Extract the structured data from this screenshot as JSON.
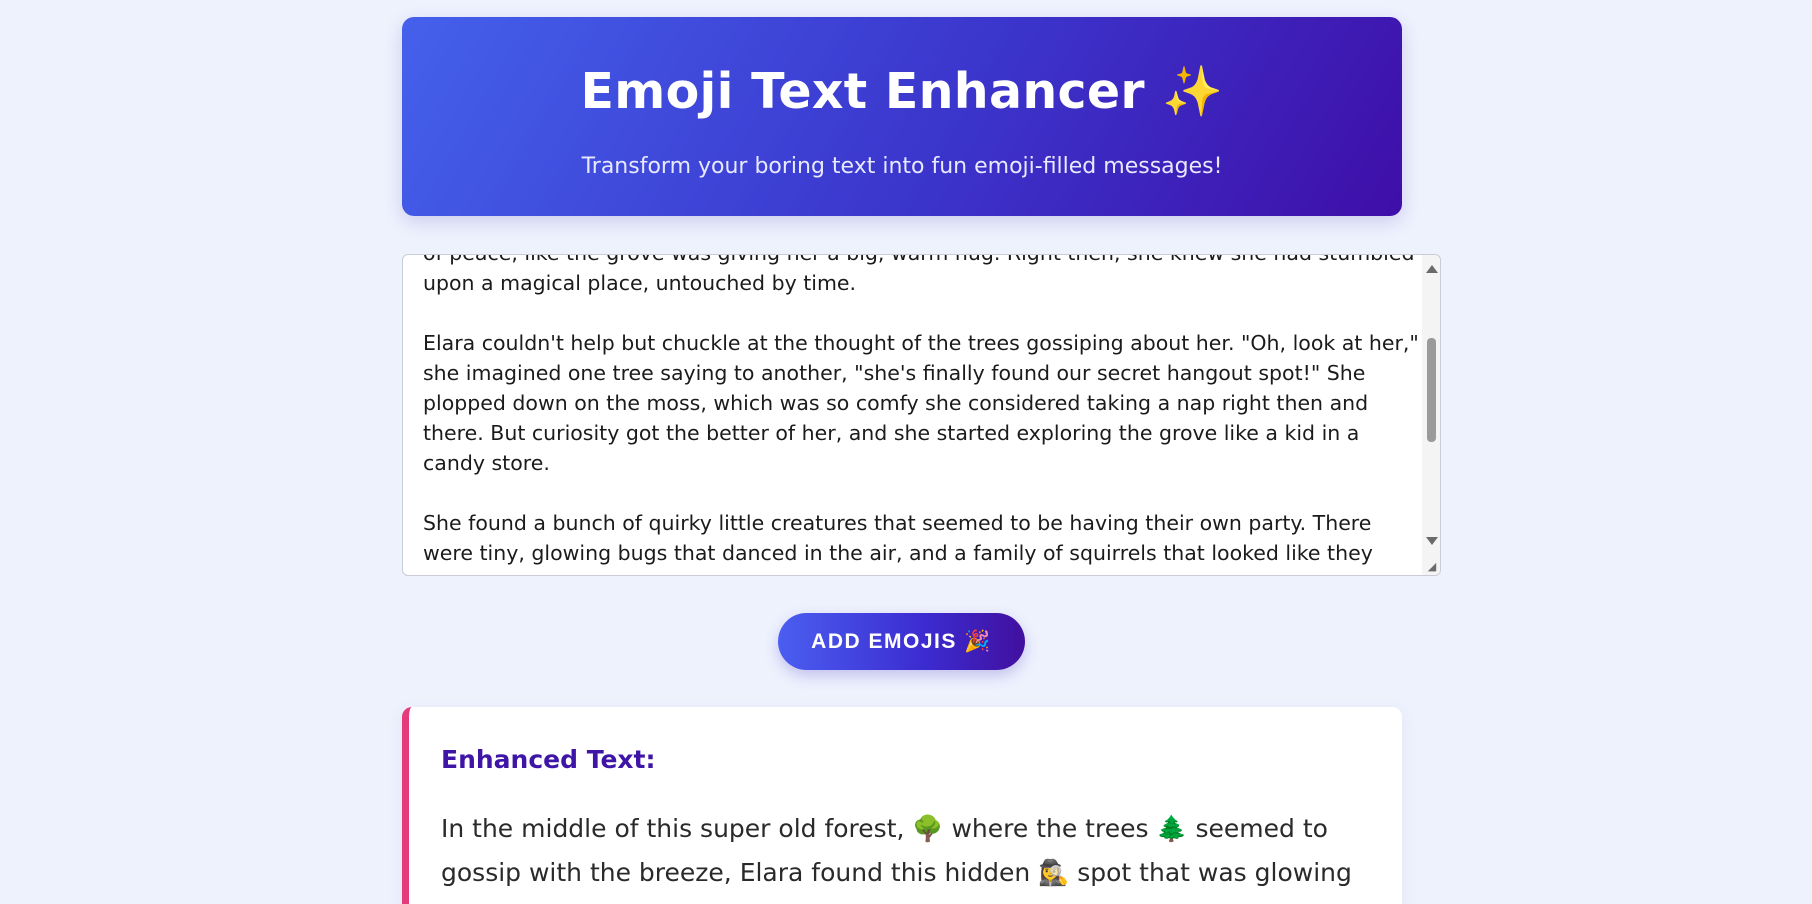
{
  "header": {
    "title": "Emoji Text Enhancer",
    "title_emoji": "✨",
    "subtitle": "Transform your boring text into fun emoji-filled messages!"
  },
  "input": {
    "text": "of peace, like the grove was giving her a big, warm hug. Right then, she knew she had stumbled upon a magical place, untouched by time.\n\nElara couldn't help but chuckle at the thought of the trees gossiping about her. \"Oh, look at her,\" she imagined one tree saying to another, \"she's finally found our secret hangout spot!\" She plopped down on the moss, which was so comfy she considered taking a nap right then and there. But curiosity got the better of her, and she started exploring the grove like a kid in a candy store.\n\nShe found a bunch of quirky little creatures that seemed to be having their own party. There were tiny, glowing bugs that danced in the air, and a family of squirrels that looked like they were"
  },
  "button": {
    "label": "ADD EMOJIS 🎉"
  },
  "result": {
    "heading": "Enhanced Text:",
    "text": "In the middle of this super old forest, 🌳 where the trees 🌲 seemed to gossip with the breeze, Elara found this hidden 🕵️‍♀️ spot that was glowing with a"
  },
  "icons": {
    "scroll_up": "scroll-up-arrow-icon",
    "scroll_down": "scroll-down-arrow-icon",
    "resize": "resize-handle-icon"
  },
  "colors": {
    "background": "#eef2fd",
    "header_gradient_start": "#4461ec",
    "header_gradient_end": "#3f0ea8",
    "button_gradient_start": "#4b5ef0",
    "button_gradient_end": "#41109f",
    "result_accent": "#e63b7a",
    "result_heading": "#3f15a8"
  }
}
